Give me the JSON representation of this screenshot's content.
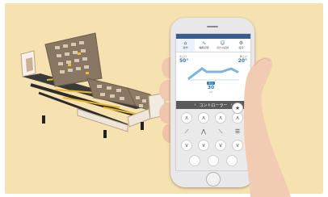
{
  "phone_app": {
    "tabs": [
      {
        "icon": "home-icon",
        "label": "操作"
      },
      {
        "icon": "chart-icon",
        "label": "睡眠記録"
      },
      {
        "icon": "user-icon",
        "label": "ほかの記録"
      },
      {
        "icon": "gear-icon",
        "label": "設定"
      }
    ],
    "back_angle": "50°",
    "back_angle_label": "背上げ",
    "leg_angle": "20°",
    "leg_angle_label": "脚上げ",
    "height_tag": "高さ",
    "height_value": "30",
    "height_unit": "cm",
    "controller_title": "コントローラー",
    "controller_buttons": [
      "∧",
      "∧",
      "∧",
      "∧",
      "∨",
      "∨",
      "∨",
      "∨"
    ],
    "favorite_icon": "★"
  },
  "colors": {
    "background": "#f6e1b1",
    "accent": "#2f79b8",
    "header": "#3a5c8e"
  }
}
